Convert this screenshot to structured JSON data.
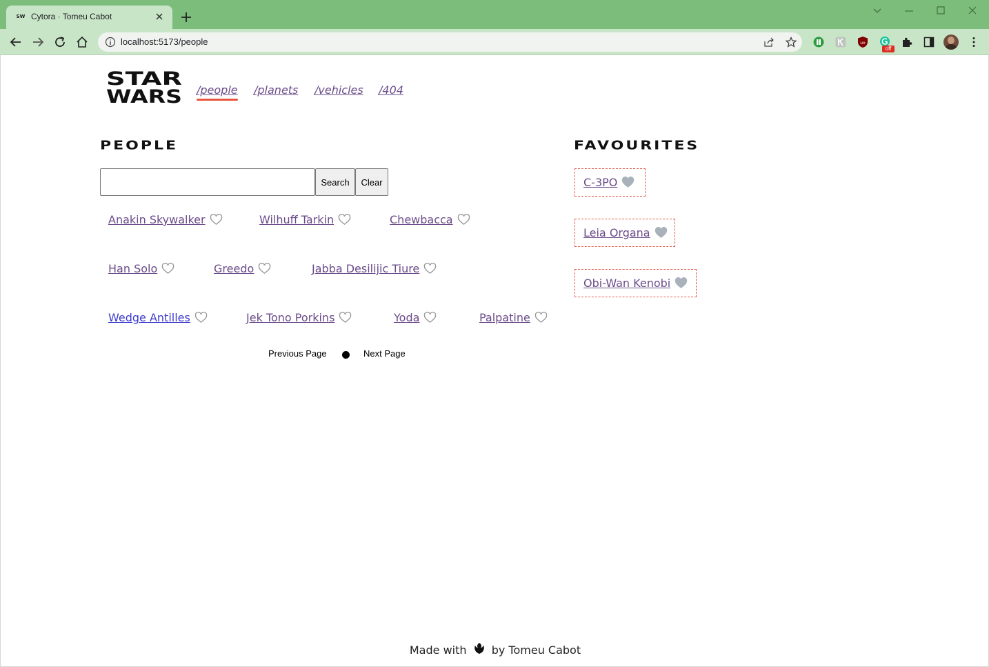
{
  "browser": {
    "tab_title": "Cytora · Tomeu Cabot",
    "tab_favicon_text": "SW",
    "url": "localhost:5173/people",
    "ext_off_badge": "off"
  },
  "nav": {
    "links": [
      "/people",
      "/planets",
      "/vehicles",
      "/404"
    ],
    "active": "/people"
  },
  "logo": {
    "line1": "STAR",
    "line2": "WARS"
  },
  "people": {
    "title": "PEOPLE",
    "search": {
      "value": "",
      "placeholder": ""
    },
    "search_label": "Search",
    "clear_label": "Clear",
    "list": [
      "Anakin Skywalker",
      "Wilhuff Tarkin",
      "Chewbacca",
      "Han Solo",
      "Greedo",
      "Jabba Desilijic Tiure",
      "Wedge Antilles",
      "Jek Tono Porkins",
      "Yoda",
      "Palpatine"
    ],
    "prev_label": "Previous Page",
    "next_label": "Next Page"
  },
  "favourites": {
    "title": "FAVOURITES",
    "list": [
      "C-3PO",
      "Leia Organa",
      "Obi-Wan Kenobi"
    ]
  },
  "footer": {
    "prefix": "Made with",
    "suffix": "by Tomeu Cabot"
  },
  "colors": {
    "tabstrip": "#7cbd7c",
    "toolbar": "#c9e5c8",
    "link": "#6b4b8a",
    "accent": "#e8553e",
    "heart_outline": "#9a9a9a",
    "heart_filled": "#a9b2bb"
  }
}
